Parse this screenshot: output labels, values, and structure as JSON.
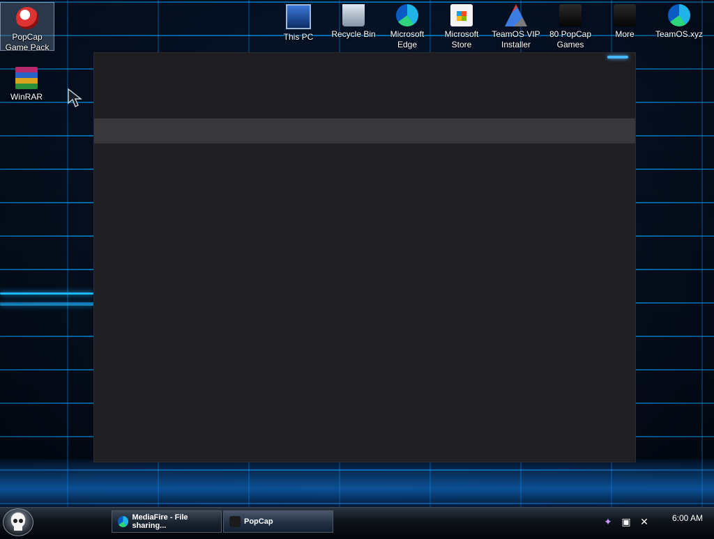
{
  "desktop": {
    "left_icons": [
      {
        "label": "PopCap\nGame Pack",
        "icon": "popcap-icon",
        "selected": true
      },
      {
        "label": "WinRAR",
        "icon": "winrar-icon"
      }
    ],
    "top_icons": [
      {
        "label": "This PC",
        "icon": "computer-icon"
      },
      {
        "label": "Recycle Bin",
        "icon": "recycle-bin-icon"
      },
      {
        "label": "Microsoft\nEdge",
        "icon": "edge-icon"
      },
      {
        "label": "Microsoft\nStore",
        "icon": "store-icon"
      },
      {
        "label": "TeamOS VIP\nInstaller",
        "icon": "teamos-icon"
      },
      {
        "label": "80 PopCap\nGames",
        "icon": "popcap-games-icon"
      },
      {
        "label": "More",
        "icon": "more-icon"
      },
      {
        "label": "TeamOS.xyz",
        "icon": "edge-icon"
      }
    ]
  },
  "taskbar": {
    "buttons": [
      {
        "label": "MediaFire - File sharing...",
        "icon": "edge-icon"
      },
      {
        "label": "PopCap",
        "icon": "popcap-app-icon",
        "active": true
      }
    ],
    "tray": {
      "icons": [
        "feather-icon",
        "network-icon",
        "volume-muted-icon"
      ],
      "clock": "6:00 AM"
    }
  },
  "colors": {
    "accent": "#19b7ff",
    "window_bg": "#1f1f22",
    "tab_strip": "#38383c"
  }
}
